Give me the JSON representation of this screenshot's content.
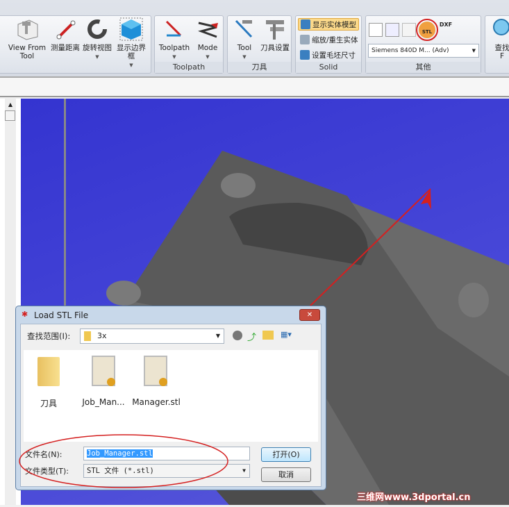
{
  "ribbon": {
    "groups": [
      {
        "label": "",
        "buttons": [
          "View From Tool",
          "测量距离",
          "旋转视图",
          "显示边界框"
        ]
      },
      {
        "label": "Toolpath",
        "buttons": [
          "Toolpath",
          "Mode"
        ]
      },
      {
        "label": "刀具",
        "buttons": [
          "Tool",
          "刀具设置"
        ]
      },
      {
        "label": "Solid",
        "buttons": [
          "显示实体模型",
          "缩放/重生实体",
          "设置毛坯尺寸"
        ]
      },
      {
        "label": "其他",
        "controller_select": "Siemens 840D M... (Adv)",
        "icons": [
          "axis-icon",
          "machine-icon",
          "stock-icon",
          "stl-icon",
          "dxf-icon"
        ],
        "stl_label": "STL",
        "dxf_label": "DXF"
      },
      {
        "label": "",
        "buttons": [
          "查找",
          "F"
        ]
      }
    ]
  },
  "dialog": {
    "title": "Load STL File",
    "look_in_label": "查找范围(I):",
    "look_in_value": "3x",
    "files": [
      {
        "name": "刀具",
        "type": "folder"
      },
      {
        "name": "Job_Man...",
        "type": "stl"
      },
      {
        "name": "Manager.stl",
        "type": "stl"
      }
    ],
    "filename_label": "文件名(N):",
    "filename_value": "Job_Manager.stl",
    "filetype_label": "文件类型(T):",
    "filetype_value": "STL 文件 (*.stl)",
    "open_label": "打开(O)",
    "cancel_label": "取消",
    "close_label": "✕"
  },
  "watermark": "三维网www.3dportal.cn",
  "colors": {
    "viewport": "#3a3ad2",
    "annotation": "#d42020",
    "selection": "#3399ff"
  }
}
